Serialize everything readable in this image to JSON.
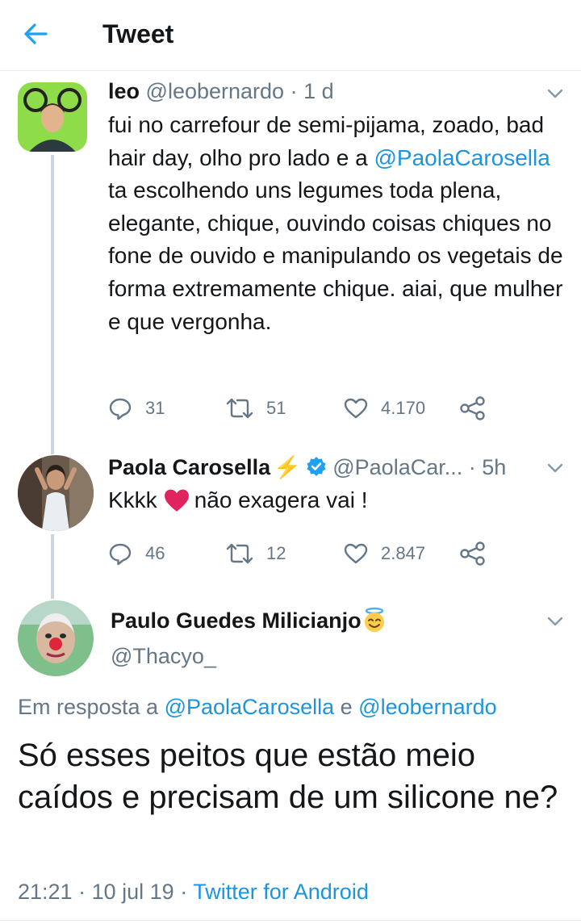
{
  "header": {
    "title": "Tweet",
    "back_icon": "arrow-left-icon",
    "accent": "#1da1f2"
  },
  "colors": {
    "link": "#1b95e0",
    "muted": "#657786",
    "text": "#14171a",
    "thread": "#ccd6dd"
  },
  "tweets": [
    {
      "name": "leo",
      "handle": "@leobernardo",
      "separator": "·",
      "time": "1 d",
      "text_before": "fui no carrefour de semi-pijama, zoado, bad hair day, olho pro lado e a ",
      "mention": "@PaolaCarosella",
      "text_after": " ta escolhendo uns legumes toda plena, elegante, chique, ouvindo coisas chiques no fone de ouvido e manipulando os vegetais de forma extremamente chique. aiai, que mulher e que vergonha.",
      "replies": "31",
      "retweets": "51",
      "likes": "4.170"
    },
    {
      "name": "Paola Carosella",
      "name_emoji": "⚡",
      "handle": "@PaolaCar...",
      "separator": "·",
      "time": "5h",
      "text_before": "Kkkk",
      "text_after": "não exagera vai !",
      "replies": "46",
      "retweets": "12",
      "likes": "2.847"
    }
  ],
  "main_tweet": {
    "name": "Paulo Guedes Milicianjo",
    "handle": "@Thacyo_",
    "reply_prefix": "Em resposta a",
    "reply_to_1": "@PaolaCarosella",
    "reply_joiner": "e",
    "reply_to_2": "@leobernardo",
    "text": "Só esses peitos que estão meio caídos e precisam de um silicone ne?",
    "time": "21:21",
    "separator": "·",
    "date": "10 jul 19",
    "source": "Twitter for Android"
  }
}
